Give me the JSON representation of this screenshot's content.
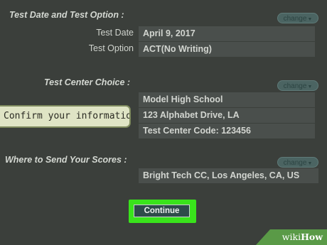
{
  "sections": {
    "test_date": {
      "title": "Test Date and Test Option :",
      "change_label": "change",
      "rows": [
        {
          "label": "Test Date",
          "value": "April 9, 2017"
        },
        {
          "label": "Test Option",
          "value": "ACT(No Writing)"
        }
      ]
    },
    "test_center": {
      "title": "Test Center Choice :",
      "change_label": "change",
      "lines": [
        "Model High School",
        "123 Alphabet Drive, LA",
        "Test Center Code: 123456"
      ]
    },
    "scores": {
      "title": "Where to Send Your Scores :",
      "change_label": "change",
      "value": "Bright Tech CC, Los Angeles, CA, US"
    }
  },
  "callout": "Confirm your information",
  "continue_label": "Continue",
  "watermark": {
    "brand_prefix": "wiki",
    "brand_suffix": "How"
  },
  "colors": {
    "highlight": "#39e31b",
    "button": "#2e4b4a",
    "callout_bg": "#dfe4c5"
  }
}
